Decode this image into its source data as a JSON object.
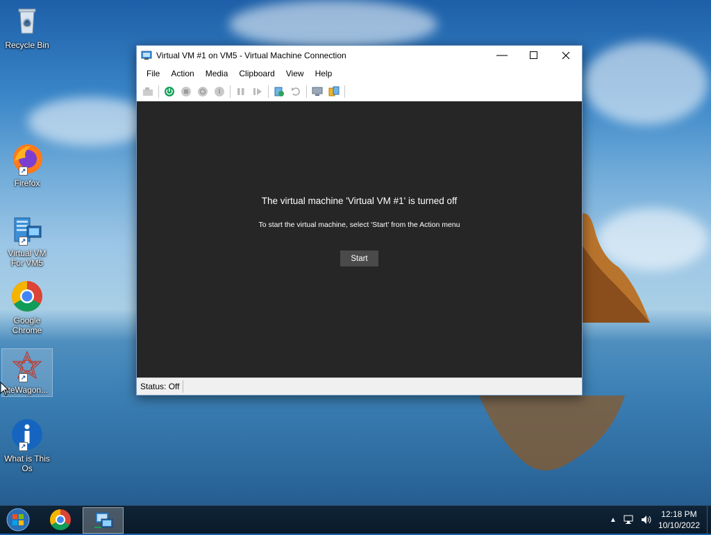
{
  "desktop": {
    "icons": [
      {
        "label": "Recycle Bin"
      },
      {
        "label": "Firefox"
      },
      {
        "label": "Virtual VM For VM5"
      },
      {
        "label": "Google Chrome"
      },
      {
        "label": "iteWagon..."
      },
      {
        "label": "What is This Os"
      }
    ]
  },
  "window": {
    "title": "Virtual VM #1 on VM5 - Virtual Machine Connection",
    "menu": [
      "File",
      "Action",
      "Media",
      "Clipboard",
      "View",
      "Help"
    ],
    "vm_message": "The virtual machine 'Virtual VM #1' is turned off",
    "vm_hint": "To start the virtual machine, select 'Start' from the Action menu",
    "start_label": "Start",
    "status": "Status: Off"
  },
  "taskbar": {
    "time": "12:18 PM",
    "date": "10/10/2022"
  },
  "colors": {
    "vm_background": "#262626",
    "start_button": "#4a4a4a",
    "taskbar": "#0f2437"
  }
}
